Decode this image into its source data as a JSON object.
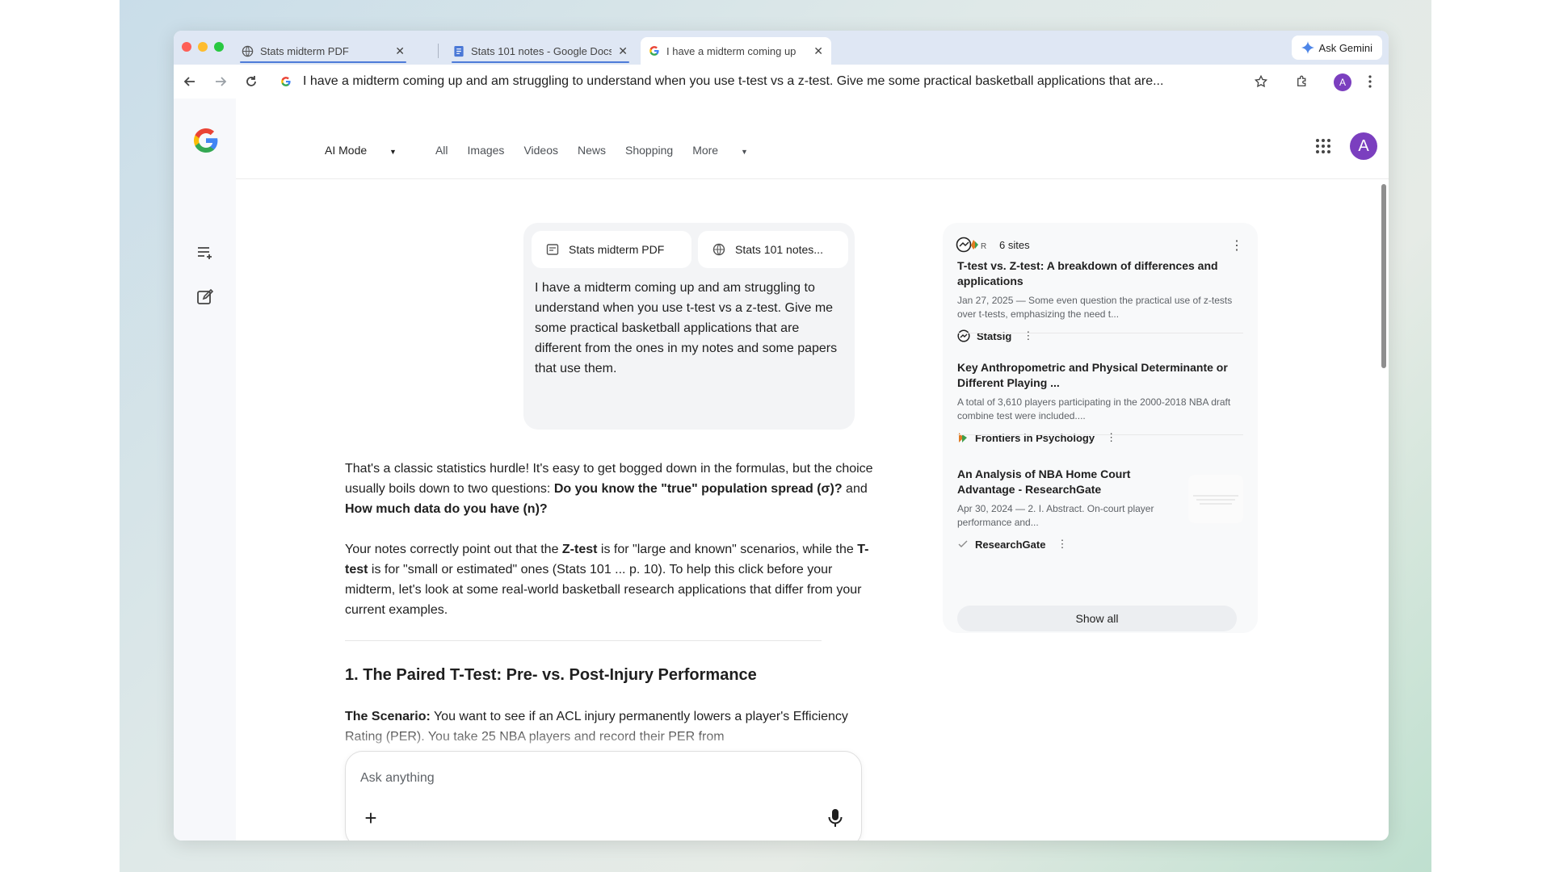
{
  "browser": {
    "tabs": [
      {
        "title": "Stats midterm PDF",
        "active": false
      },
      {
        "title": "Stats 101 notes - Google Docs",
        "active": false
      },
      {
        "title": "I have a midterm coming up",
        "active": true
      }
    ],
    "ask_gemini_label": "Ask Gemini",
    "address": "I have a midterm coming up and am struggling to understand when you use t-test vs a z-test. Give me some practical basketball applications that are...",
    "profile_initial": "A"
  },
  "search_nav": {
    "ai_mode": "AI Mode",
    "tabs": [
      "All",
      "Images",
      "Videos",
      "News",
      "Shopping",
      "More"
    ]
  },
  "avatar_initial": "A",
  "query": {
    "attachments": [
      {
        "label": "Stats midterm PDF",
        "icon": "pdf-doc-icon"
      },
      {
        "label": "Stats 101 notes...",
        "icon": "web-globe-icon"
      }
    ],
    "text": "I have a midterm coming up and am struggling to understand when you use t-test vs a z-test. Give me some practical basketball applications that are different from the ones in my notes and some papers that use them."
  },
  "answer": {
    "p1_a": "That's a classic statistics hurdle! It's easy to get bogged down in the formulas, but the choice usually boils down to two questions: ",
    "p1_b1": "Do you know the \"true\" population spread (σ)?",
    "p1_c": " and ",
    "p1_b2": "How much data do you have (n)?",
    "p2_a": "Your notes correctly point out that the ",
    "p2_b1": "Z-test",
    "p2_c": " is for \"large and known\" scenarios, while the ",
    "p2_b2": "T-test",
    "p2_d": " is for \"small or estimated\" ones (Stats 101 ... p. 10). To help this click before your midterm, let's look at some real-world basketball research applications that differ from your current examples.",
    "h1": "1. The Paired T-Test: Pre- vs. Post-Injury Performance",
    "p3_b": "The Scenario:",
    "p3_a": " You want to see if an ACL injury permanently lowers a player's Efficiency Rating (PER). You take 25 NBA players and record their PER from"
  },
  "ask": {
    "placeholder": "Ask anything"
  },
  "sources": {
    "count_label": "6 sites",
    "items": [
      {
        "title": "T-test vs. Z-test: A breakdown of differences and applications",
        "snippet": "Jan 27, 2025 — Some even question the practical use of z-tests over t-tests, emphasizing the need t...",
        "site": "Statsig"
      },
      {
        "title": "Key Anthropometric and Physical Determinante or Different Playing ...",
        "snippet": "A total of 3,610 players participating in the 2000-2018 NBA draft combine test were included....",
        "site": "Frontiers in Psychology"
      },
      {
        "title": "An Analysis of NBA Home Court Advantage - ResearchGate",
        "snippet": "Apr 30, 2024 — 2. I. Abstract. On-court player performance and...",
        "site": "ResearchGate"
      }
    ],
    "show_all": "Show all"
  },
  "colors": {
    "accent": "#7b3fbf",
    "tab_indicator": "#4e7bd8"
  }
}
